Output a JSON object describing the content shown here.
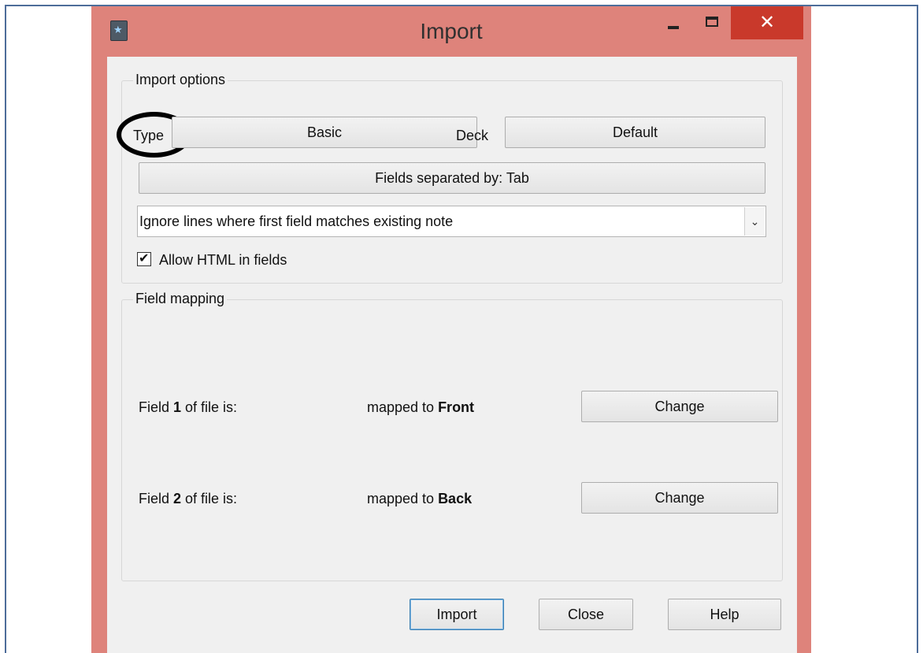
{
  "window": {
    "title": "Import",
    "close_glyph": "✕"
  },
  "import_options": {
    "group_title": "Import options",
    "type_label": "Type",
    "type_value": "Basic",
    "deck_label": "Deck",
    "deck_value": "Default",
    "separator_button": "Fields separated by: Tab",
    "duplicate_mode": "Ignore lines where first field matches existing note",
    "allow_html_label": "Allow HTML in fields",
    "allow_html_checked": true
  },
  "field_mapping": {
    "group_title": "Field mapping",
    "rows": [
      {
        "prefix": "Field ",
        "number": "1",
        "suffix": " of file is:",
        "mapped_prefix": "mapped to ",
        "target": "Front",
        "button": "Change"
      },
      {
        "prefix": "Field ",
        "number": "2",
        "suffix": " of file is:",
        "mapped_prefix": "mapped to ",
        "target": "Back",
        "button": "Change"
      }
    ]
  },
  "footer": {
    "import_button": "Import",
    "close_button": "Close",
    "help_button": "Help"
  },
  "colors": {
    "window_frame": "#de837b",
    "close_button": "#c9392b",
    "dialog_bg": "#f0f0f0",
    "outer_border": "#4d6d9a"
  },
  "icons": [
    "app-icon",
    "minimize-icon",
    "maximize-icon",
    "close-icon",
    "chevron-down-icon",
    "checkmark-icon"
  ]
}
